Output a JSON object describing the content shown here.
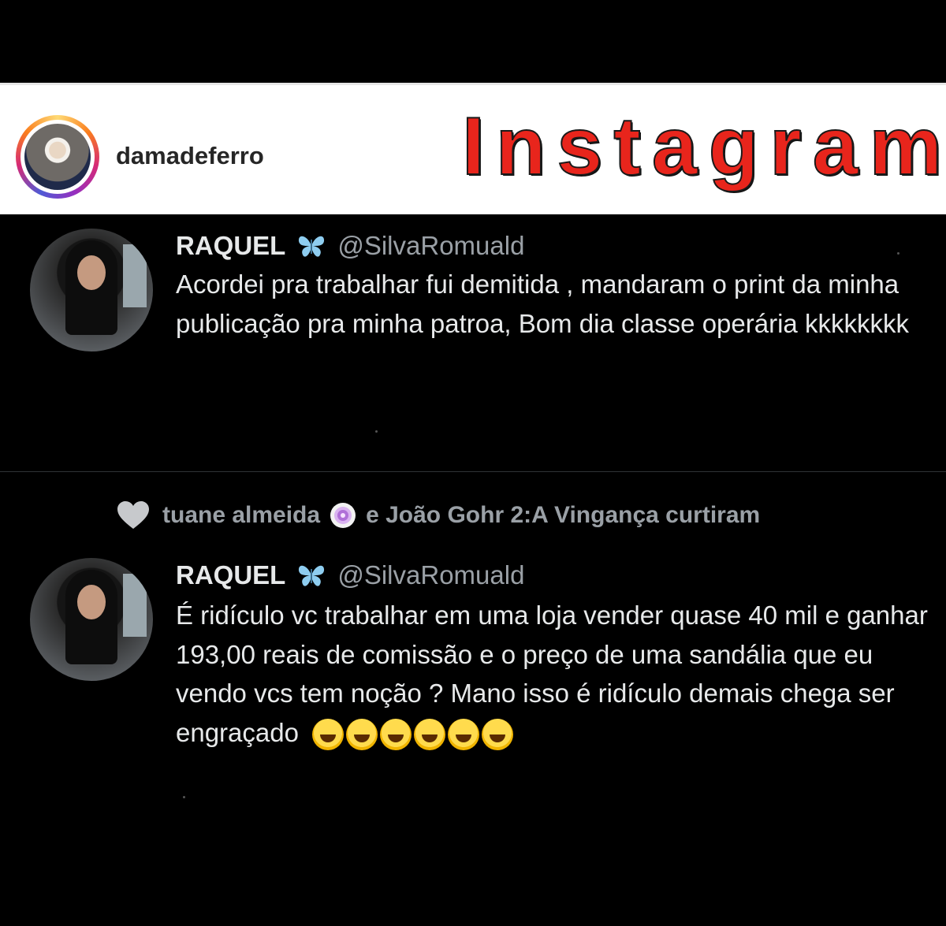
{
  "instagram": {
    "username": "damadeferro",
    "brand": "Instagram"
  },
  "tweets": [
    {
      "name": "RAQUEL",
      "badge_icon": "butterfly-icon",
      "handle": "@SilvaRomuald",
      "text": "Acordei pra trabalhar fui demitida , mandaram o print da minha publicação pra minha patroa, Bom dia classe operária kkkkkkkk"
    },
    {
      "name": "RAQUEL",
      "badge_icon": "butterfly-icon",
      "handle": "@SilvaRomuald",
      "text": "É ridículo vc trabalhar em uma loja vender quase 40 mil e ganhar 193,00 reais  de comissão e o preço de uma sandália que eu vendo vcs tem noção ? Mano isso é ridículo demais chega ser engraçado",
      "emoji": "🤣🤣🤣🤣🤣🤣"
    }
  ],
  "like_context": {
    "user1": "tuane almeida",
    "rest": "e João Gohr 2:A Vingança curtiram",
    "icon": "heart-icon"
  },
  "colors": {
    "background": "#000000",
    "brand_red": "#e8251c",
    "text_primary": "#e7e9ea",
    "text_secondary": "#9aa0a6"
  }
}
